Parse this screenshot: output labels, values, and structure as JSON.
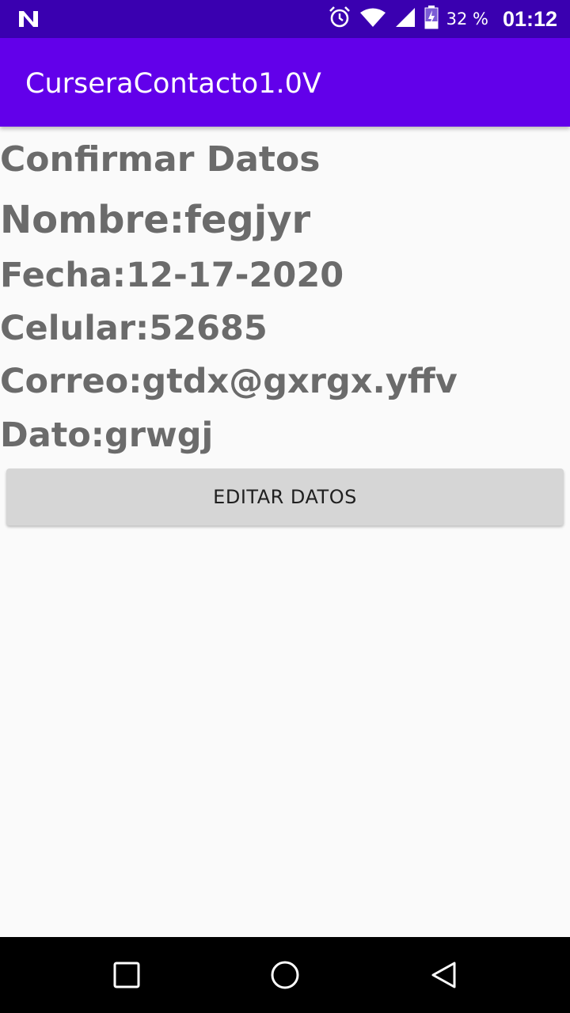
{
  "status_bar": {
    "battery_percent": "32 %",
    "time": "01:12",
    "icons": [
      "n-notification-icon",
      "alarm-icon",
      "wifi-icon",
      "signal-icon",
      "battery-charging-icon"
    ]
  },
  "app_bar": {
    "title": "CurseraContacto1.0V"
  },
  "confirm": {
    "heading": "Confirmar Datos",
    "nombre": "Nombre:fegjyr",
    "fecha": "Fecha:12-17-2020",
    "celular": "Celular:52685",
    "correo": "Correo:gtdx@gxrgx.yffv",
    "dato": "Dato:grwgj"
  },
  "actions": {
    "edit_label": "EDITAR DATOS"
  },
  "nav_bar": {
    "buttons": [
      "recents-icon",
      "home-icon",
      "back-icon"
    ]
  },
  "colors": {
    "status_bar": "#3a00b0",
    "app_bar": "#6200ea",
    "text_gray": "#6b6b6b",
    "button_bg": "#d6d6d6"
  }
}
